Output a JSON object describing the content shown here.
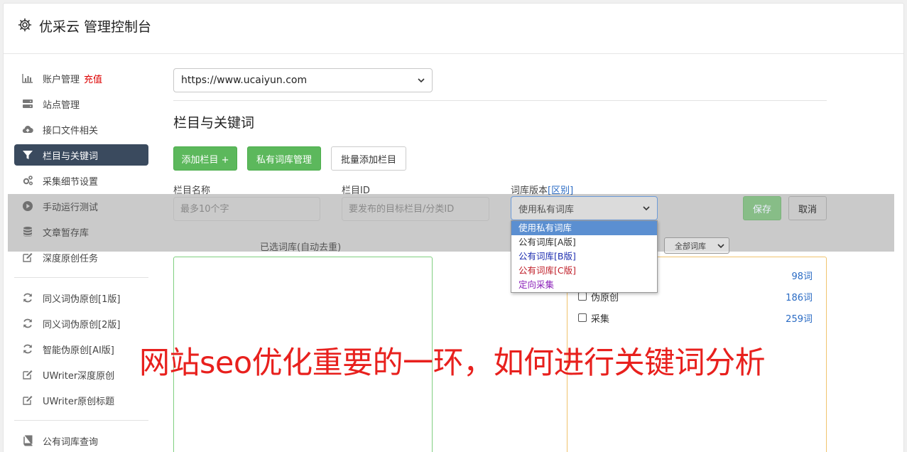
{
  "header": {
    "title": "优采云 管理控制台"
  },
  "sidebar": {
    "items": [
      {
        "label": "账户管理",
        "badge": "充值",
        "icon": "bar-chart-icon"
      },
      {
        "label": "站点管理",
        "icon": "server-icon"
      },
      {
        "label": "接口文件相关",
        "icon": "cloud-upload-icon"
      },
      {
        "label": "栏目与关键词",
        "icon": "filter-icon",
        "active": true
      },
      {
        "label": "采集细节设置",
        "icon": "cogs-icon"
      },
      {
        "label": "手动运行测试",
        "icon": "play-icon"
      },
      {
        "label": "文章暂存库",
        "icon": "database-icon"
      },
      {
        "label": "深度原创任务",
        "icon": "edit-icon"
      },
      {
        "label": "同义词伪原创[1版]",
        "icon": "refresh-icon"
      },
      {
        "label": "同义词伪原创[2版]",
        "icon": "refresh-icon"
      },
      {
        "label": "智能伪原创[AI版]",
        "icon": "refresh-icon"
      },
      {
        "label": "UWriter深度原创",
        "icon": "edit-icon"
      },
      {
        "label": "UWriter原创标题",
        "icon": "edit-icon"
      },
      {
        "label": "公有词库查询",
        "icon": "book-icon"
      }
    ]
  },
  "main": {
    "site_select": {
      "value": "https://www.ucaiyun.com"
    },
    "section_title": "栏目与关键词",
    "buttons": {
      "add_column": "添加栏目 +",
      "private_lib": "私有词库管理",
      "batch_add": "批量添加栏目",
      "save": "保存",
      "cancel": "取消"
    },
    "form": {
      "column_name_label": "栏目名称",
      "column_name_placeholder": "最多10个字",
      "column_id_label": "栏目ID",
      "column_id_placeholder": "要发布的目标栏目/分类ID",
      "lib_version_label": "词库版本",
      "lib_version_link": "[区别]",
      "lib_version_value": "使用私有词库",
      "lib_options": [
        {
          "label": "使用私有词库",
          "color": "#ffffff"
        },
        {
          "label": "公有词库[A版]",
          "color": "#333333"
        },
        {
          "label": "公有词库[B版]",
          "color": "#1f2fb0"
        },
        {
          "label": "公有词库[C版]",
          "color": "#c0202a"
        },
        {
          "label": "定向采集",
          "color": "#8a1fb8"
        }
      ]
    },
    "selected_caption": "已选词库(自动去重)",
    "filter_value": "全部词库",
    "libraries": [
      {
        "name": "",
        "count": "98词"
      },
      {
        "name": "伪原创",
        "count": "186词"
      },
      {
        "name": "采集",
        "count": "259词"
      }
    ]
  },
  "banner_text": "网站seo优化重要的一环，如何进行关键词分析"
}
